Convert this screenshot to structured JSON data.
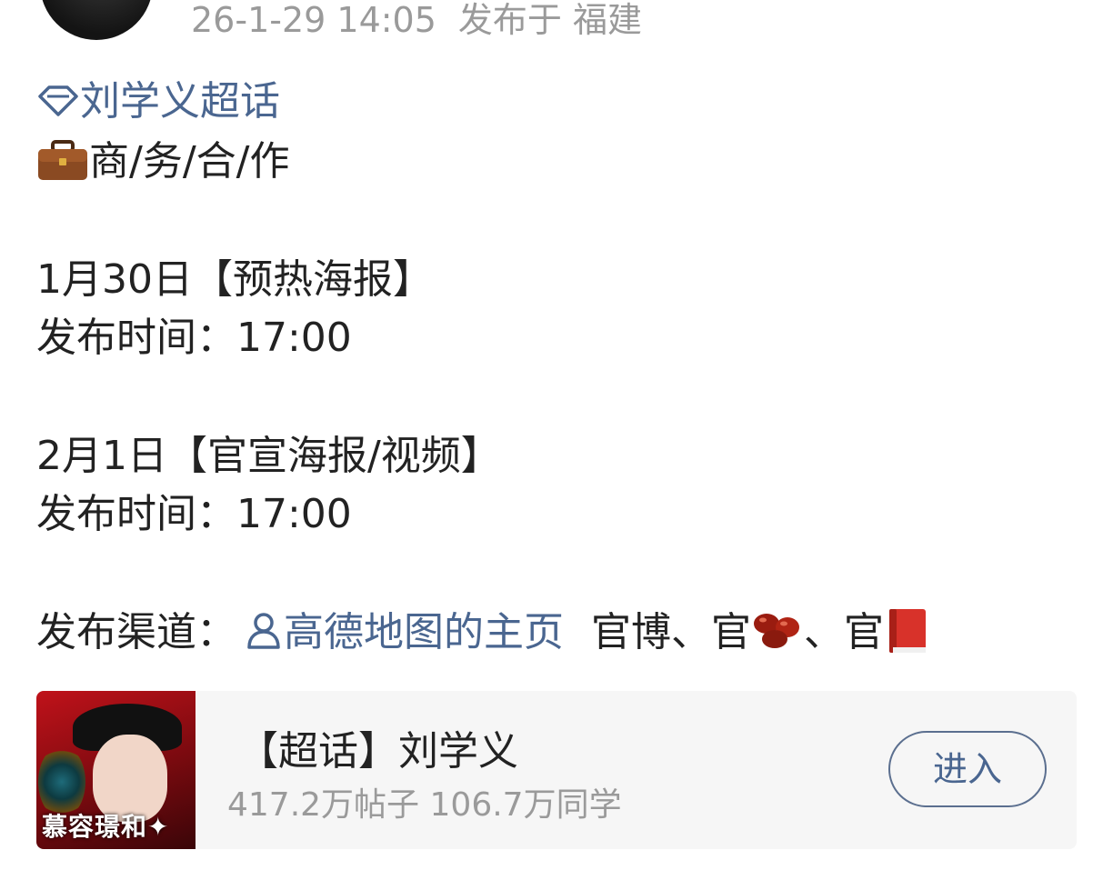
{
  "post": {
    "timestamp": "26-1-29 14:05",
    "location": "发布于 福建",
    "topic_link": "刘学义超话",
    "business_line": "商/务/合/作",
    "schedule": [
      {
        "title": "1月30日【预热海报】",
        "time": "发布时间：17:00"
      },
      {
        "title": "2月1日【官宣海报/视频】",
        "time": "发布时间：17:00"
      }
    ],
    "channel_label": "发布渠道：",
    "channel_user_link": "高德地图的主页",
    "channel_text_1": "官博、官",
    "channel_text_2": "、官"
  },
  "supertopic_card": {
    "thumbnail_caption": "慕容璟和✦",
    "title": "【超话】刘学义",
    "stats": "417.2万帖子 106.7万同学",
    "enter_label": "进入"
  },
  "icons": [
    "diamond-topic-icon",
    "briefcase-icon",
    "user-icon",
    "beans-icon",
    "red-book-icon"
  ],
  "colors": {
    "link": "#4a6690",
    "meta": "#9a9a9a",
    "text": "#222222",
    "card_bg": "#f6f6f6"
  }
}
